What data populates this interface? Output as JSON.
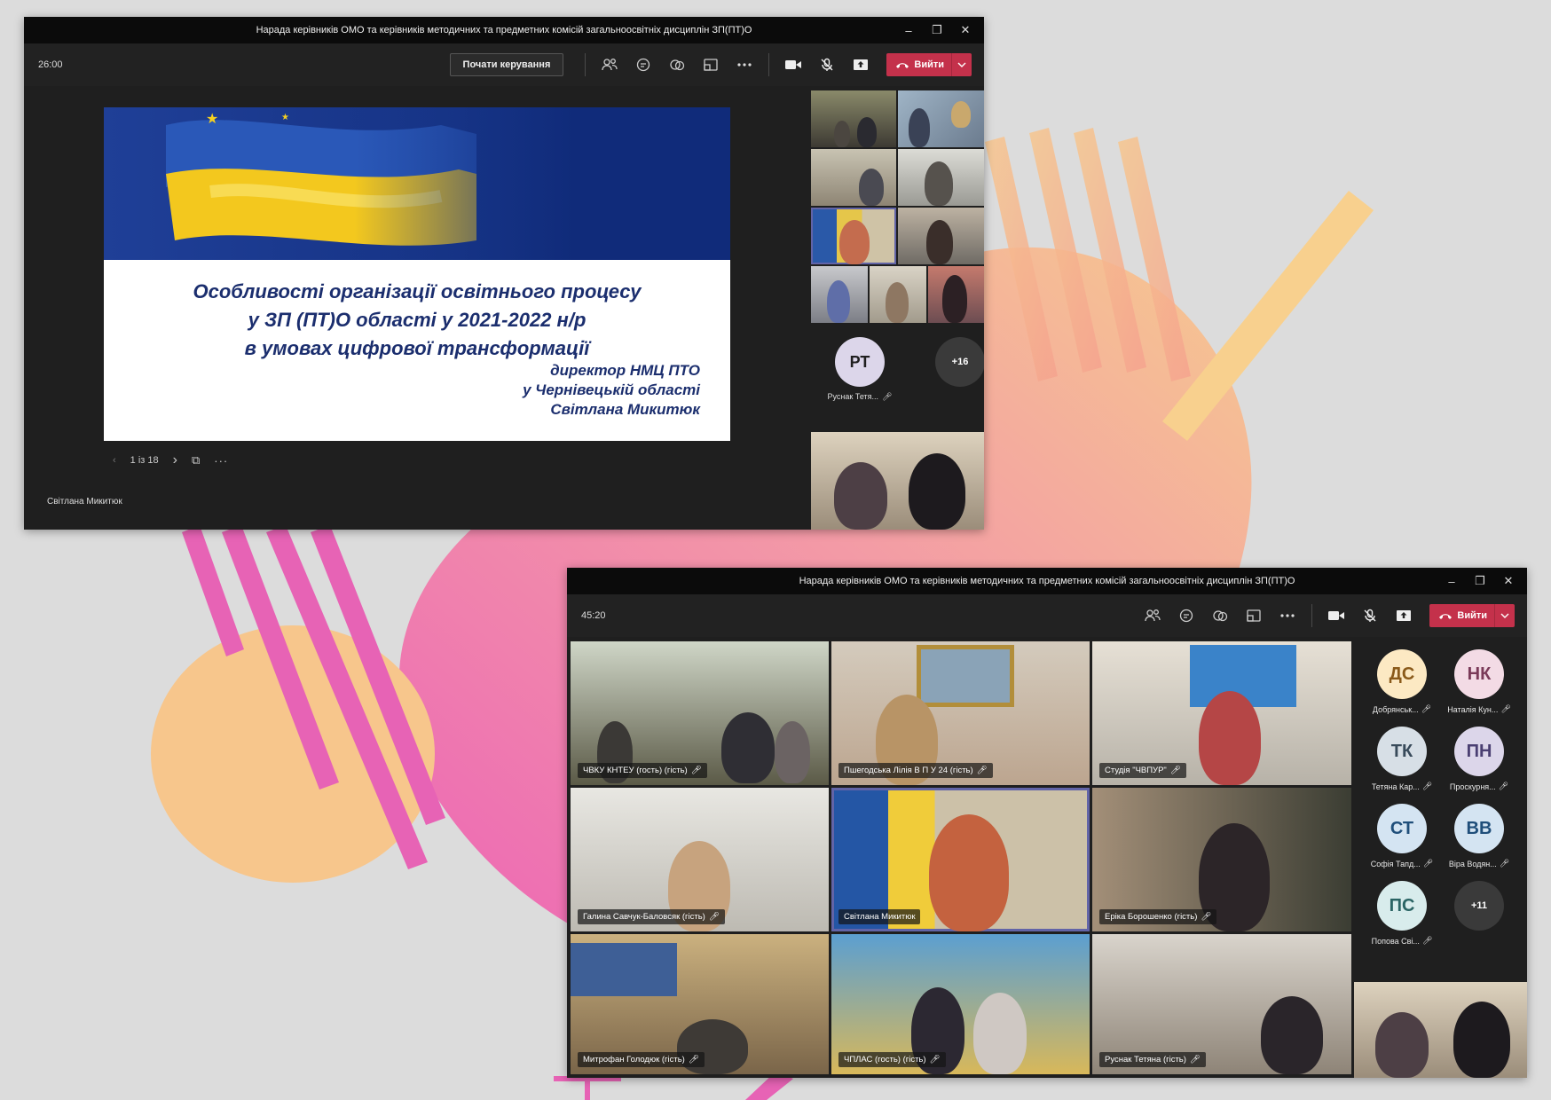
{
  "colors": {
    "leave_red": "#c4314b",
    "teams_dark": "#1f1f1f",
    "highlight_frame": "#6264a7"
  },
  "window1": {
    "title": "Нарада керівників ОМО та керівників методичних та предметних комісій загальноосвітніх дисциплін ЗП(ПТ)О",
    "timer": "26:00",
    "control_button": "Почати керування",
    "leave_label": "Вийти",
    "slide": {
      "line1": "Особливості організації  освітнього процесу",
      "line2": "у  ЗП (ПТ)О області  у 2021-2022 н/р",
      "line3": "в умовах цифрової трансформації",
      "author1": "директор  НМЦ ПТО",
      "author2": "у Чернівецькій області",
      "author3": "Світлана Микитюк"
    },
    "page_indicator": "1 із 18",
    "presenter": "Світлана Микитюк",
    "avatar_initials": "РТ",
    "avatar_name": "Руснак Тетя...",
    "more_count": "+16"
  },
  "window2": {
    "title": "Нарада керівників ОМО та керівників методичних та предметних комісій загальноосвітніх дисциплін ЗП(ПТ)О",
    "timer": "45:20",
    "leave_label": "Вийти",
    "tiles": [
      {
        "name": "ЧВКУ КНТЕУ (гость) (гість)"
      },
      {
        "name": "Пшегодська Лілія В П У 24 (гість)"
      },
      {
        "name": "Студія \"ЧВПУР\""
      },
      {
        "name": "Галина Савчук-Баловсяк (гість)"
      },
      {
        "name": "Світлана Микитюк"
      },
      {
        "name": "Еріка Борошенко (гість)"
      },
      {
        "name": "Митрофан Голодюк (гість)"
      },
      {
        "name": "ЧПЛАС (гость) (гість)"
      },
      {
        "name": "Руснак Тетяна (гість)"
      }
    ],
    "roster": [
      {
        "initials": "ДС",
        "name": "Добрянськ...",
        "color": "#fce9c3"
      },
      {
        "initials": "НК",
        "name": "Наталія Кун...",
        "color": "#f3dbe5"
      },
      {
        "initials": "ТК",
        "name": "Тетяна Кар...",
        "color": "#d7dfe6"
      },
      {
        "initials": "ПН",
        "name": "Проскурня...",
        "color": "#dcd6ea"
      },
      {
        "initials": "СТ",
        "name": "Софія Тапд...",
        "color": "#d4e4f2"
      },
      {
        "initials": "ВВ",
        "name": "Віра Водян...",
        "color": "#d4e4f2"
      },
      {
        "initials": "ПС",
        "name": "Попова Сві...",
        "color": "#d8ecec"
      }
    ],
    "more_count": "+11"
  }
}
